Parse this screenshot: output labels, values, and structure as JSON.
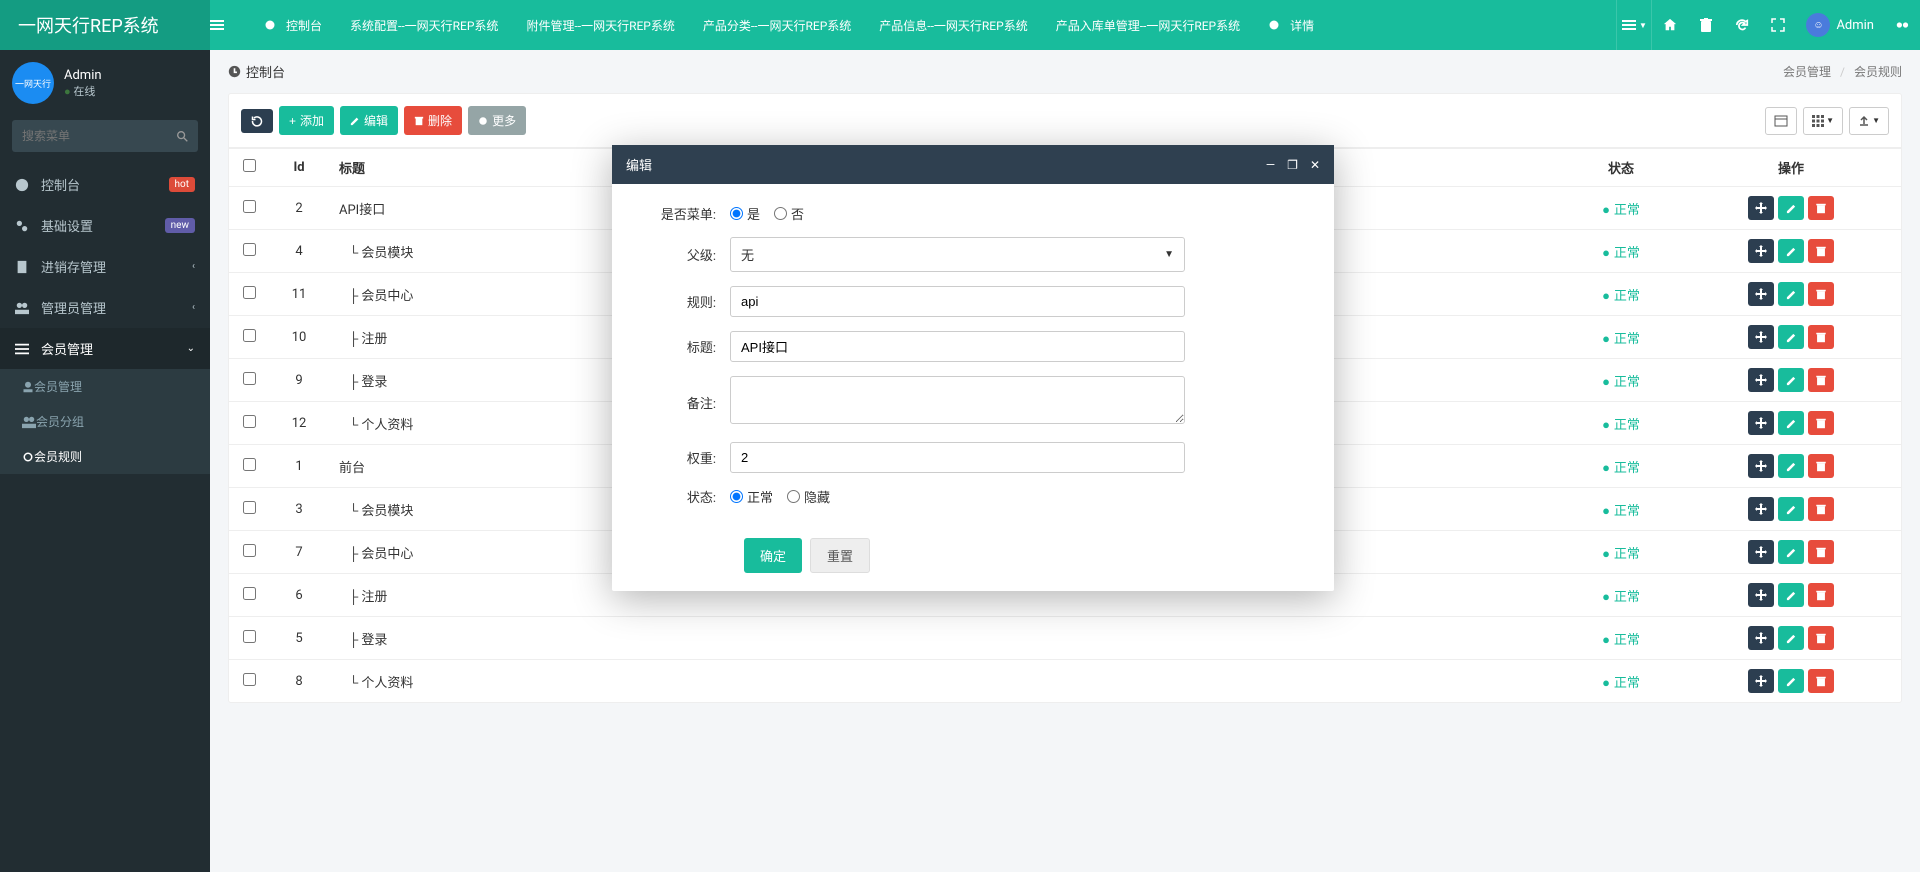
{
  "brand": "一网天行REP系统",
  "top_tabs": [
    {
      "label": "控制台",
      "icon": true
    },
    {
      "label": "系统配置--一网天行REP系统"
    },
    {
      "label": "附件管理--一网天行REP系统"
    },
    {
      "label": "产品分类--一网天行REP系统"
    },
    {
      "label": "产品信息--一网天行REP系统"
    },
    {
      "label": "产品入库单管理--一网天行REP系统"
    },
    {
      "label": "详情",
      "icon": true
    }
  ],
  "top_user": "Admin",
  "sidebar": {
    "user": {
      "name": "Admin",
      "status": "在线"
    },
    "search_placeholder": "搜索菜单",
    "menu": [
      {
        "label": "控制台",
        "badge": "hot",
        "badge_class": "label-hot",
        "icon": "dashboard"
      },
      {
        "label": "基础设置",
        "badge": "new",
        "badge_class": "label-new",
        "icon": "cogs"
      },
      {
        "label": "进销存管理",
        "caret": true,
        "icon": "file"
      },
      {
        "label": "管理员管理",
        "caret": true,
        "icon": "users"
      },
      {
        "label": "会员管理",
        "caret": true,
        "open": true,
        "active": true,
        "icon": "list",
        "sub": [
          {
            "label": "会员管理",
            "icon": "user"
          },
          {
            "label": "会员分组",
            "icon": "users"
          },
          {
            "label": "会员规则",
            "icon": "circle",
            "active": true
          }
        ]
      }
    ]
  },
  "header": {
    "title": "控制台",
    "breadcrumb": [
      "会员管理",
      "会员规则"
    ]
  },
  "toolbar": {
    "add": "添加",
    "edit": "编辑",
    "delete": "删除",
    "more": "更多"
  },
  "table": {
    "columns": [
      "",
      "Id",
      "标题",
      "状态",
      "操作"
    ],
    "status_label": "正常",
    "rows": [
      {
        "id": 2,
        "title": "API接口"
      },
      {
        "id": 4,
        "title": "└ 会员模块"
      },
      {
        "id": 11,
        "title": "├ 会员中心"
      },
      {
        "id": 10,
        "title": "├ 注册"
      },
      {
        "id": 9,
        "title": "├ 登录"
      },
      {
        "id": 12,
        "title": "└ 个人资料"
      },
      {
        "id": 1,
        "title": "前台"
      },
      {
        "id": 3,
        "title": "└ 会员模块"
      },
      {
        "id": 7,
        "title": "├ 会员中心"
      },
      {
        "id": 6,
        "title": "├ 注册"
      },
      {
        "id": 5,
        "title": "├ 登录"
      },
      {
        "id": 8,
        "title": "└ 个人资料"
      }
    ]
  },
  "modal": {
    "title": "编辑",
    "fields": {
      "ismenu_label": "是否菜单:",
      "ismenu_yes": "是",
      "ismenu_no": "否",
      "parent_label": "父级:",
      "parent_value": "无",
      "rule_label": "规则:",
      "rule_value": "api",
      "title_label": "标题:",
      "title_value": "API接口",
      "remark_label": "备注:",
      "remark_value": "",
      "weight_label": "权重:",
      "weight_value": "2",
      "status_label": "状态:",
      "status_normal": "正常",
      "status_hidden": "隐藏"
    },
    "submit": "确定",
    "reset": "重置"
  }
}
